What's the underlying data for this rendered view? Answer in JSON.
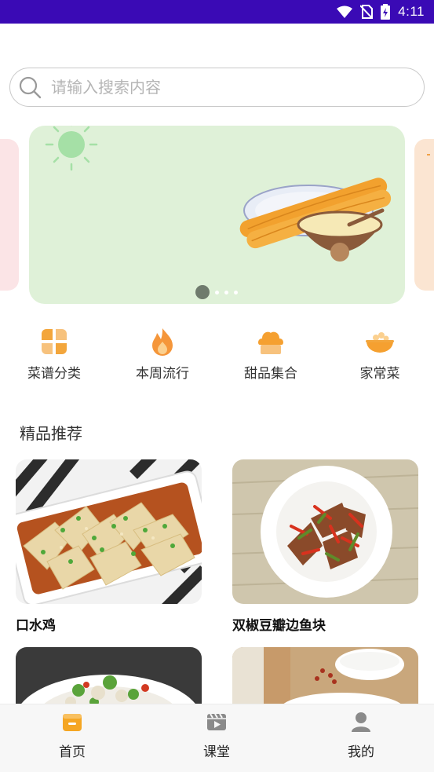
{
  "status_bar": {
    "time": "4:11",
    "icons": [
      "wifi-icon",
      "no-sim-icon",
      "battery-charging-icon"
    ]
  },
  "search": {
    "placeholder": "请输入搜索内容",
    "icon": "search-icon"
  },
  "banner": {
    "page_index": 1,
    "page_count": 4
  },
  "categories": [
    {
      "label": "菜谱分类",
      "icon": "grid-petals-icon"
    },
    {
      "label": "本周流行",
      "icon": "flame-icon"
    },
    {
      "label": "甜品集合",
      "icon": "cupcake-icon"
    },
    {
      "label": "家常菜",
      "icon": "bowl-icon"
    }
  ],
  "section": {
    "title": "精品推荐"
  },
  "recipes": [
    {
      "title": "口水鸡"
    },
    {
      "title": "双椒豆瓣边鱼块"
    },
    {
      "title": ""
    },
    {
      "title": ""
    }
  ],
  "tabbar": {
    "items": [
      {
        "label": "首页",
        "icon": "home-box-icon",
        "active": true
      },
      {
        "label": "课堂",
        "icon": "video-clapper-icon",
        "active": false
      },
      {
        "label": "我的",
        "icon": "user-icon",
        "active": false
      }
    ]
  },
  "colors": {
    "status_bar": "#3a0ab5",
    "accent": "#f5a623",
    "banner_bg": "#dff1d8",
    "tab_inactive": "#8a8a8a"
  }
}
